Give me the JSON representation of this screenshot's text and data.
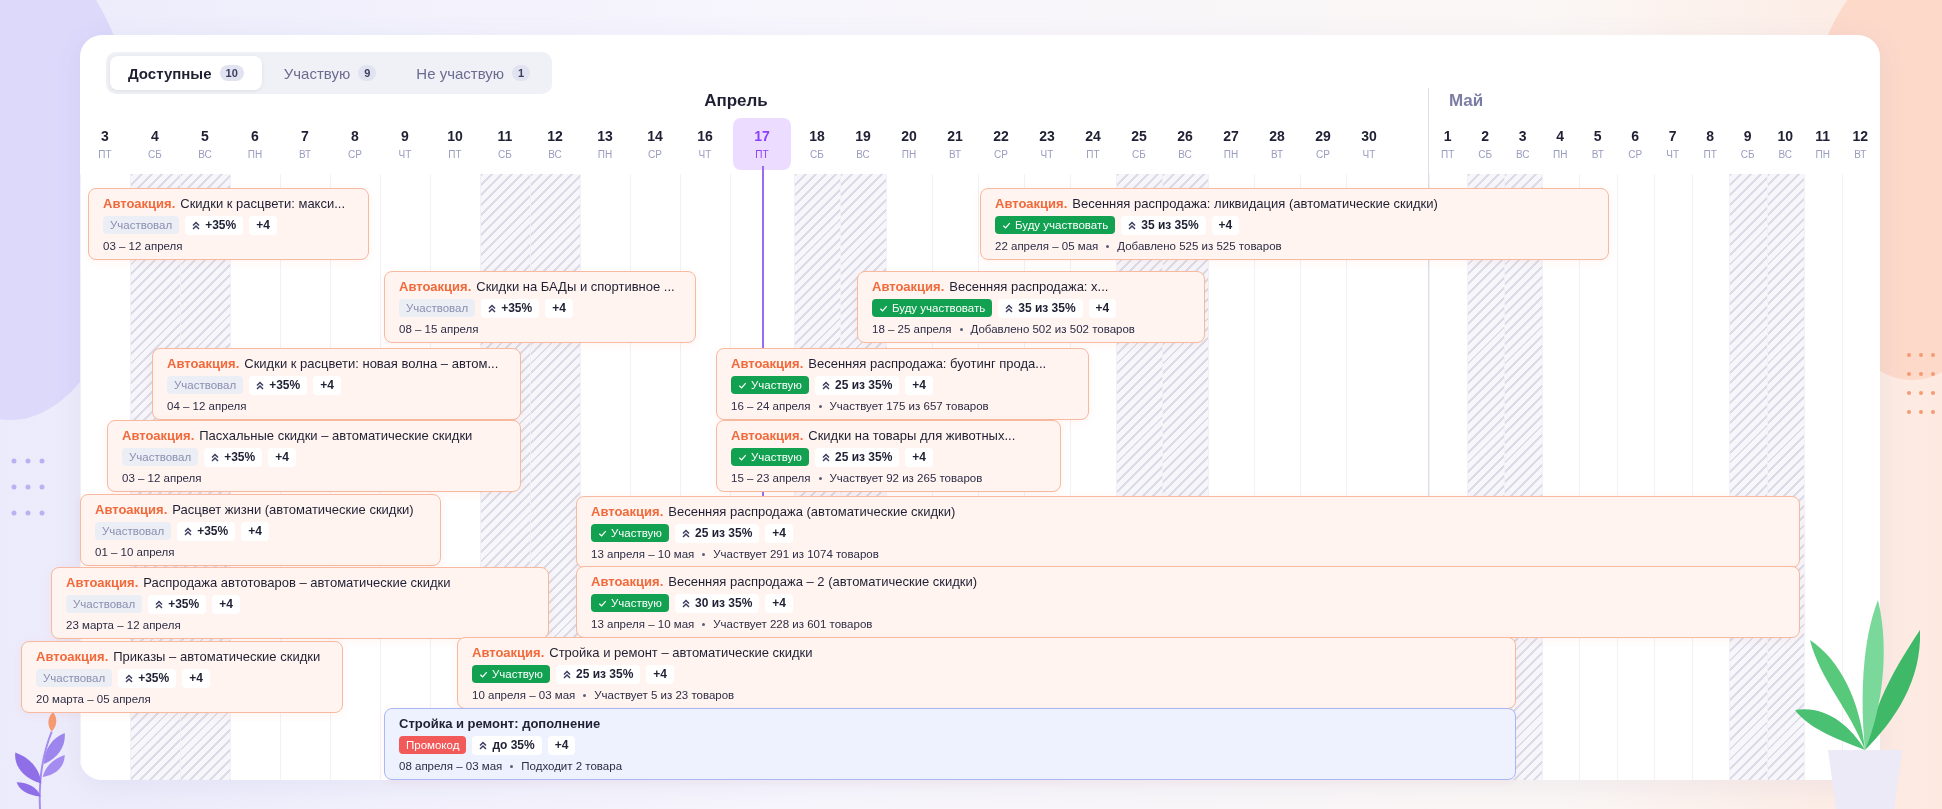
{
  "tabs": [
    {
      "label": "Доступные",
      "count": "10",
      "selected": true
    },
    {
      "label": "Участвую",
      "count": "9",
      "selected": false
    },
    {
      "label": "Не участвую",
      "count": "1",
      "selected": false
    }
  ],
  "months": [
    {
      "name": "Апрель",
      "current": true,
      "days": [
        {
          "day": "3",
          "weekday": "ПТ",
          "weekend": false,
          "today": false
        },
        {
          "day": "4",
          "weekday": "СБ",
          "weekend": true,
          "today": false
        },
        {
          "day": "5",
          "weekday": "ВС",
          "weekend": true,
          "today": false
        },
        {
          "day": "6",
          "weekday": "ПН",
          "weekend": false,
          "today": false
        },
        {
          "day": "7",
          "weekday": "ВТ",
          "weekend": false,
          "today": false
        },
        {
          "day": "8",
          "weekday": "СР",
          "weekend": false,
          "today": false
        },
        {
          "day": "9",
          "weekday": "ЧТ",
          "weekend": false,
          "today": false
        },
        {
          "day": "10",
          "weekday": "ПТ",
          "weekend": false,
          "today": false
        },
        {
          "day": "11",
          "weekday": "СБ",
          "weekend": true,
          "today": false
        },
        {
          "day": "12",
          "weekday": "ВС",
          "weekend": true,
          "today": false
        },
        {
          "day": "13",
          "weekday": "ПН",
          "weekend": false,
          "today": false
        },
        {
          "day": "14",
          "weekday": "СР",
          "weekend": false,
          "today": false
        },
        {
          "day": "16",
          "weekday": "ЧТ",
          "weekend": false,
          "today": false
        },
        {
          "day": "17",
          "weekday": "ПТ",
          "weekend": false,
          "today": true
        },
        {
          "day": "18",
          "weekday": "СБ",
          "weekend": true,
          "today": false
        },
        {
          "day": "19",
          "weekday": "ВС",
          "weekend": true,
          "today": false
        },
        {
          "day": "20",
          "weekday": "ПН",
          "weekend": false,
          "today": false
        },
        {
          "day": "21",
          "weekday": "ВТ",
          "weekend": false,
          "today": false
        },
        {
          "day": "22",
          "weekday": "СР",
          "weekend": false,
          "today": false
        },
        {
          "day": "23",
          "weekday": "ЧТ",
          "weekend": false,
          "today": false
        },
        {
          "day": "24",
          "weekday": "ПТ",
          "weekend": false,
          "today": false
        },
        {
          "day": "25",
          "weekday": "СБ",
          "weekend": true,
          "today": false
        },
        {
          "day": "26",
          "weekday": "ВС",
          "weekend": true,
          "today": false
        },
        {
          "day": "27",
          "weekday": "ПН",
          "weekend": false,
          "today": false
        },
        {
          "day": "28",
          "weekday": "ВТ",
          "weekend": false,
          "today": false
        },
        {
          "day": "29",
          "weekday": "СР",
          "weekend": false,
          "today": false
        },
        {
          "day": "30",
          "weekday": "ЧТ",
          "weekend": false,
          "today": false
        }
      ]
    },
    {
      "name": "Май",
      "current": false,
      "days": [
        {
          "day": "1",
          "weekday": "ПТ",
          "weekend": false,
          "today": false
        },
        {
          "day": "2",
          "weekday": "СБ",
          "weekend": true,
          "today": false
        },
        {
          "day": "3",
          "weekday": "ВС",
          "weekend": true,
          "today": false
        },
        {
          "day": "4",
          "weekday": "ПН",
          "weekend": false,
          "today": false
        },
        {
          "day": "5",
          "weekday": "ВТ",
          "weekend": false,
          "today": false
        },
        {
          "day": "6",
          "weekday": "СР",
          "weekend": false,
          "today": false
        },
        {
          "day": "7",
          "weekday": "ЧТ",
          "weekend": false,
          "today": false
        },
        {
          "day": "8",
          "weekday": "ПТ",
          "weekend": false,
          "today": false
        },
        {
          "day": "9",
          "weekday": "СБ",
          "weekend": true,
          "today": false
        },
        {
          "day": "10",
          "weekday": "ВС",
          "weekend": true,
          "today": false
        },
        {
          "day": "11",
          "weekday": "ПН",
          "weekend": false,
          "today": false
        },
        {
          "day": "12",
          "weekday": "ВТ",
          "weekend": false,
          "today": false
        }
      ]
    }
  ],
  "promotions": [
    {
      "kind": "auto",
      "tag": "Автоакция.",
      "title": "Скидки к расцвети: макси...",
      "status": {
        "kind": "participated",
        "label": "Участвовал"
      },
      "discount": "+35%",
      "extra": "+4",
      "dates": "03 – 12 апреля"
    },
    {
      "kind": "auto",
      "tag": "Автоакция.",
      "title": "Весенняя распродажа: ликвидация (автоматические скидки)",
      "status": {
        "kind": "planned",
        "label": "Буду участвовать"
      },
      "discount": "35 из 35%",
      "extra": "+4",
      "dates": "22 апреля – 05 мая",
      "note": "Добавлено 525 из 525 товаров"
    },
    {
      "kind": "auto",
      "tag": "Автоакция.",
      "title": "Скидки на БАДы и спортивное ...",
      "status": {
        "kind": "participated",
        "label": "Участвовал"
      },
      "discount": "+35%",
      "extra": "+4",
      "dates": "08 – 15 апреля"
    },
    {
      "kind": "auto",
      "tag": "Автоакция.",
      "title": "Весенняя распродажа: х...",
      "status": {
        "kind": "planned",
        "label": "Буду участвовать"
      },
      "discount": "35 из 35%",
      "extra": "+4",
      "dates": "18 – 25 апреля",
      "note": "Добавлено 502 из 502 товаров"
    },
    {
      "kind": "auto",
      "tag": "Автоакция.",
      "title": "Скидки к расцвети: новая волна – автом...",
      "status": {
        "kind": "participated",
        "label": "Участвовал"
      },
      "discount": "+35%",
      "extra": "+4",
      "dates": "04 – 12 апреля"
    },
    {
      "kind": "auto",
      "tag": "Автоакция.",
      "title": "Весенняя распродажа: буотинг прода...",
      "status": {
        "kind": "active",
        "label": "Участвую"
      },
      "discount": "25 из 35%",
      "extra": "+4",
      "dates": "16 – 24 апреля",
      "note": "Участвует 175 из 657 товаров"
    },
    {
      "kind": "auto",
      "tag": "Автоакция.",
      "title": "Пасхальные скидки – автоматические скидки",
      "status": {
        "kind": "participated",
        "label": "Участвовал"
      },
      "discount": "+35%",
      "extra": "+4",
      "dates": "03 – 12 апреля"
    },
    {
      "kind": "auto",
      "tag": "Автоакция.",
      "title": "Скидки на товары для животных...",
      "status": {
        "kind": "active",
        "label": "Участвую"
      },
      "discount": "25 из 35%",
      "extra": "+4",
      "dates": "15 – 23 апреля",
      "note": "Участвует 92 из 265 товаров"
    },
    {
      "kind": "auto",
      "tag": "Автоакция.",
      "title": "Расцвет жизни (автоматические скидки)",
      "status": {
        "kind": "participated",
        "label": "Участвовал"
      },
      "discount": "+35%",
      "extra": "+4",
      "dates": "01 – 10 апреля"
    },
    {
      "kind": "auto",
      "tag": "Автоакция.",
      "title": "Весенняя распродажа (автоматические скидки)",
      "status": {
        "kind": "active",
        "label": "Участвую"
      },
      "discount": "25 из 35%",
      "extra": "+4",
      "dates": "13 апреля – 10 мая",
      "note": "Участвует 291 из 1074 товаров"
    },
    {
      "kind": "auto",
      "tag": "Автоакция.",
      "title": "Распродажа автотоваров – автоматические скидки",
      "status": {
        "kind": "participated",
        "label": "Участвовал"
      },
      "discount": "+35%",
      "extra": "+4",
      "dates": "23 марта – 12 апреля"
    },
    {
      "kind": "auto",
      "tag": "Автоакция.",
      "title": "Весенняя распродажа – 2 (автоматические скидки)",
      "status": {
        "kind": "active",
        "label": "Участвую"
      },
      "discount": "30 из 35%",
      "extra": "+4",
      "dates": "13 апреля – 10 мая",
      "note": "Участвует 228 из 601 товаров"
    },
    {
      "kind": "auto",
      "tag": "Автоакция.",
      "title": "Приказы – автоматические скидки",
      "status": {
        "kind": "participated",
        "label": "Участвовал"
      },
      "discount": "+35%",
      "extra": "+4",
      "dates": "20 марта – 05 апреля"
    },
    {
      "kind": "auto",
      "tag": "Автоакция.",
      "title": "Стройка и ремонт – автоматические скидки",
      "status": {
        "kind": "active",
        "label": "Участвую"
      },
      "discount": "25 из 35%",
      "extra": "+4",
      "dates": "10 апреля – 03 мая",
      "note": "Участвует 5 из 23 товаров"
    },
    {
      "kind": "promo",
      "title": "Стройка и ремонт: дополнение",
      "status": {
        "kind": "promocode",
        "label": "Промокод"
      },
      "discount": "до 35%",
      "extra": "+4",
      "dates": "08 апреля – 03 мая",
      "note": "Подходит 2 товара"
    }
  ]
}
